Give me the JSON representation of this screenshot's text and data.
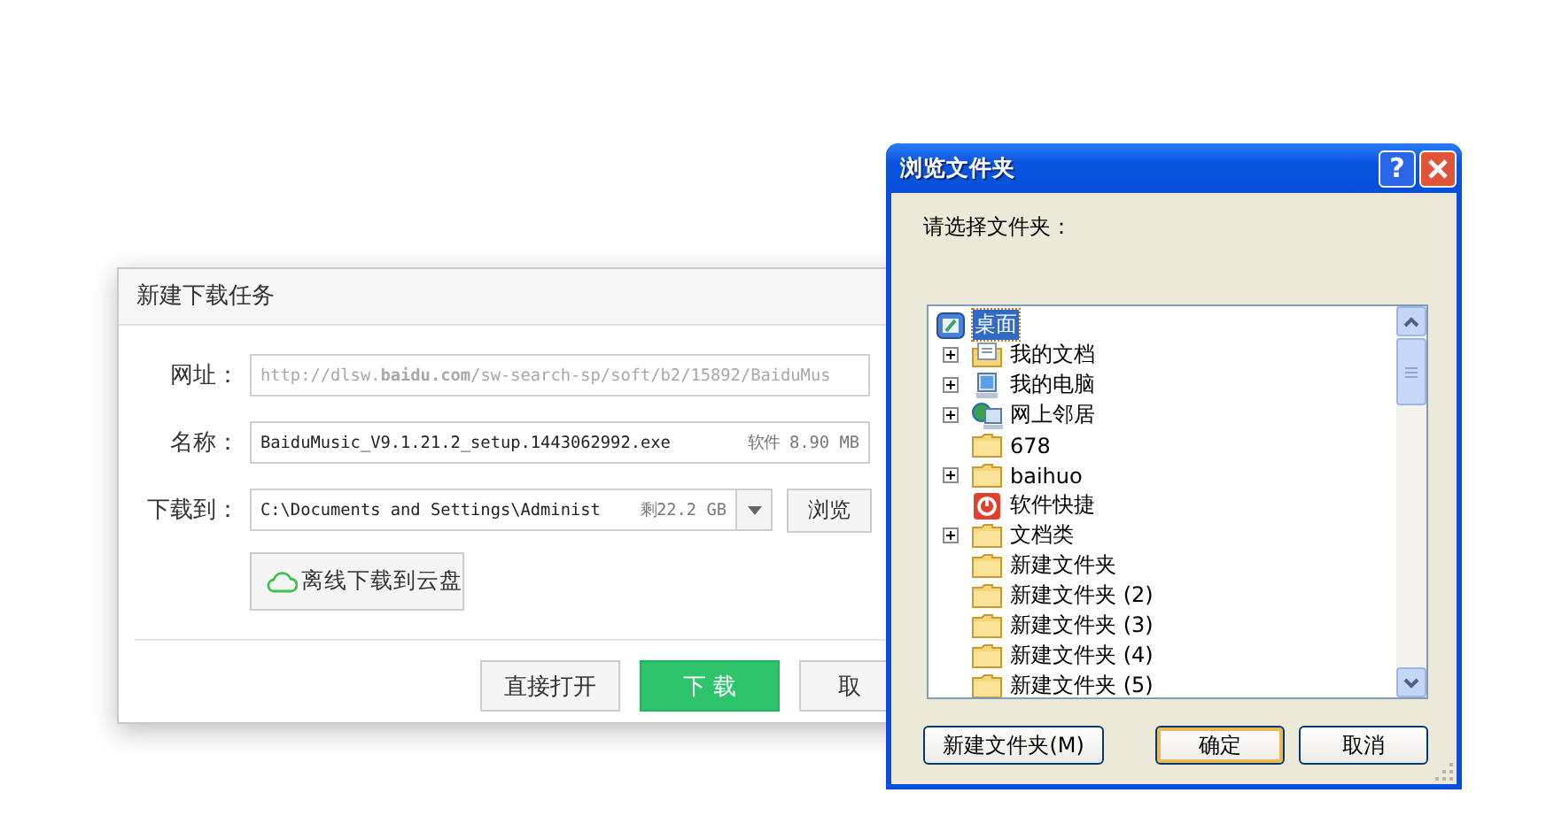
{
  "download_dialog": {
    "title": "新建下载任务",
    "url": {
      "label": "网址：",
      "value": "http://dlsw.**baidu.com**/sw-search-sp/soft/b2/15892/BaiduMus"
    },
    "name": {
      "label": "名称：",
      "value": "BaiduMusic_V9.1.21.2_setup.1443062992.exe",
      "size": "软件 8.90 MB"
    },
    "save_to": {
      "label": "下载到：",
      "value": "C:\\Documents and Settings\\Administ",
      "free": "剩22.2 GB",
      "browse": "浏览"
    },
    "cloud_button": "离线下载到云盘",
    "buttons": [
      {
        "label": "直接打开",
        "kind": "plain"
      },
      {
        "label": "下 载",
        "kind": "primary"
      },
      {
        "label": "取",
        "kind": "plain"
      }
    ]
  },
  "browse_dialog": {
    "title": "浏览文件夹",
    "help": "?",
    "prompt": "请选择文件夹：",
    "tree": [
      {
        "label": "桌面",
        "kind": "desktop",
        "selected": true,
        "expandable": false,
        "children": [
          {
            "label": "我的文档",
            "kind": "documents",
            "selected": false,
            "expandable": true
          },
          {
            "label": "我的电脑",
            "kind": "computer",
            "selected": false,
            "expandable": true
          },
          {
            "label": "网上邻居",
            "kind": "network",
            "selected": false,
            "expandable": true
          },
          {
            "label": "678",
            "kind": "folder",
            "selected": false,
            "expandable": false
          },
          {
            "label": "baihuo",
            "kind": "folder",
            "selected": false,
            "expandable": true
          },
          {
            "label": "软件快捷",
            "kind": "shortcut",
            "selected": false,
            "expandable": false
          },
          {
            "label": "文档类",
            "kind": "folder",
            "selected": false,
            "expandable": true
          },
          {
            "label": "新建文件夹",
            "kind": "folder",
            "selected": false,
            "expandable": false
          },
          {
            "label": "新建文件夹 (2)",
            "kind": "folder",
            "selected": false,
            "expandable": false
          },
          {
            "label": "新建文件夹 (3)",
            "kind": "folder",
            "selected": false,
            "expandable": false
          },
          {
            "label": "新建文件夹 (4)",
            "kind": "folder",
            "selected": false,
            "expandable": false
          },
          {
            "label": "新建文件夹 (5)",
            "kind": "folder",
            "selected": false,
            "expandable": false
          }
        ]
      }
    ],
    "buttons": [
      {
        "label": "新建文件夹(M)",
        "focused": false
      },
      {
        "label": "确定",
        "focused": true
      },
      {
        "label": "取消",
        "focused": false
      }
    ]
  }
}
